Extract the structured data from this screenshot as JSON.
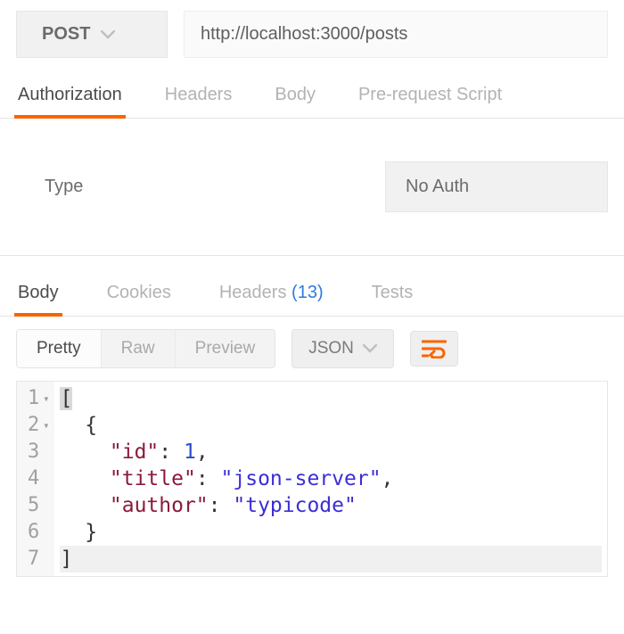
{
  "request": {
    "method": "POST",
    "url": "http://localhost:3000/posts"
  },
  "tabs": {
    "authorization": "Authorization",
    "headers": "Headers",
    "body": "Body",
    "prerequest": "Pre-request Script"
  },
  "auth": {
    "label": "Type",
    "value": "No Auth"
  },
  "responseTabs": {
    "body": "Body",
    "cookies": "Cookies",
    "headers": "Headers",
    "headersCount": "(13)",
    "tests": "Tests"
  },
  "viewModes": {
    "pretty": "Pretty",
    "raw": "Raw",
    "preview": "Preview"
  },
  "format": {
    "selected": "JSON"
  },
  "code": {
    "lines": [
      {
        "n": "1",
        "fold": true
      },
      {
        "n": "2",
        "fold": true
      },
      {
        "n": "3",
        "fold": false
      },
      {
        "n": "4",
        "fold": false
      },
      {
        "n": "5",
        "fold": false
      },
      {
        "n": "6",
        "fold": false
      },
      {
        "n": "7",
        "fold": false
      }
    ],
    "payload": {
      "id_key": "\"id\"",
      "id_val": "1",
      "title_key": "\"title\"",
      "title_val": "\"json-server\"",
      "author_key": "\"author\"",
      "author_val": "\"typicode\""
    }
  }
}
